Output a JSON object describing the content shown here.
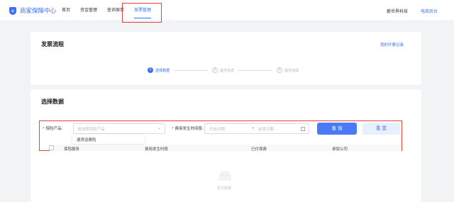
{
  "header": {
    "logo_text": "商家保障中心",
    "nav": [
      {
        "label": "首页",
        "active": false
      },
      {
        "label": "资金管理",
        "active": false
      },
      {
        "label": "查询保单",
        "active": false
      },
      {
        "label": "发票管理",
        "active": true
      }
    ],
    "company": "爵世界科技",
    "ecommerce_link": "电商后台"
  },
  "flow": {
    "title": "发票流程",
    "records_link": "我的开票记录",
    "steps": [
      {
        "num": "1",
        "label": "选择数据",
        "active": true
      },
      {
        "num": "2",
        "label": "提交信息",
        "active": false
      },
      {
        "num": "3",
        "label": "提交完成",
        "active": false
      }
    ]
  },
  "selection": {
    "title": "选择数据",
    "product_label": "保险产品:",
    "product_placeholder": "请选择保险产品",
    "dropdown_option": "退货运费险",
    "time_label": "费用发生时间段:",
    "start_placeholder": "开始日期",
    "range_sep": "→",
    "end_placeholder": "结束日期",
    "query_button": "查 询",
    "reset_button": "重 置",
    "columns": [
      "保险服务",
      "费用发生时段",
      "已付保费",
      "承保公司"
    ],
    "empty_text": "暂无数据"
  },
  "colors": {
    "accent": "#3b6ff5",
    "highlight": "#e8413a"
  }
}
